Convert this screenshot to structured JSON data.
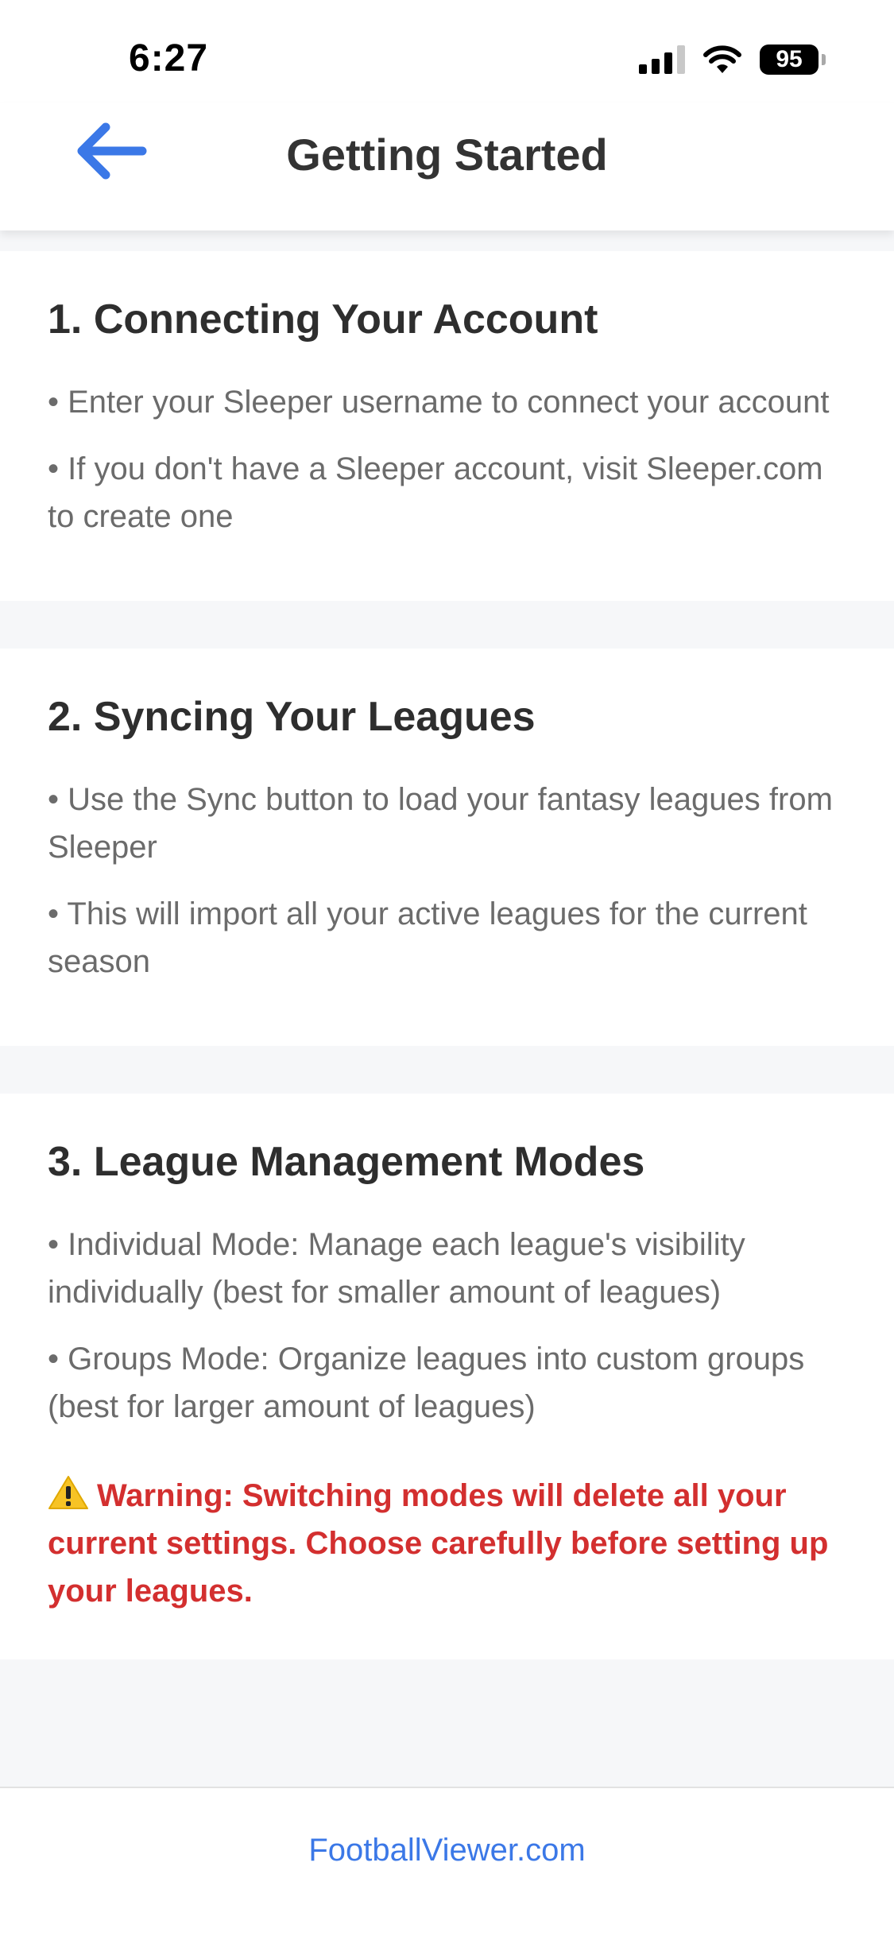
{
  "status_bar": {
    "time": "6:27",
    "battery_level": "95",
    "icons": [
      "cellular-signal-icon",
      "wifi-icon",
      "battery-icon"
    ]
  },
  "header": {
    "title": "Getting Started",
    "back_icon": "back-arrow-icon"
  },
  "sections": [
    {
      "heading": "1. Connecting Your Account",
      "bullets": [
        "• Enter your Sleeper username to connect your account",
        "• If you don't have a Sleeper account, visit Sleeper.com to create one"
      ]
    },
    {
      "heading": "2. Syncing Your Leagues",
      "bullets": [
        "• Use the Sync button to load your fantasy leagues from Sleeper",
        "• This will import all your active leagues for the current season"
      ]
    },
    {
      "heading": "3. League Management Modes",
      "bullets": [
        "• Individual Mode: Manage each league's visibility individually (best for smaller amount of leagues)",
        "• Groups Mode: Organize leagues into custom groups (best for larger amount of leagues)"
      ],
      "warning": "Warning: Switching modes will delete all your current settings. Choose carefully before setting up your leagues."
    }
  ],
  "footer": {
    "link_text": "FootballViewer.com"
  },
  "colors": {
    "accent": "#3b78e7",
    "warning": "#d32f2f",
    "page_bg": "#f6f7f9",
    "card_bg": "#ffffff"
  }
}
